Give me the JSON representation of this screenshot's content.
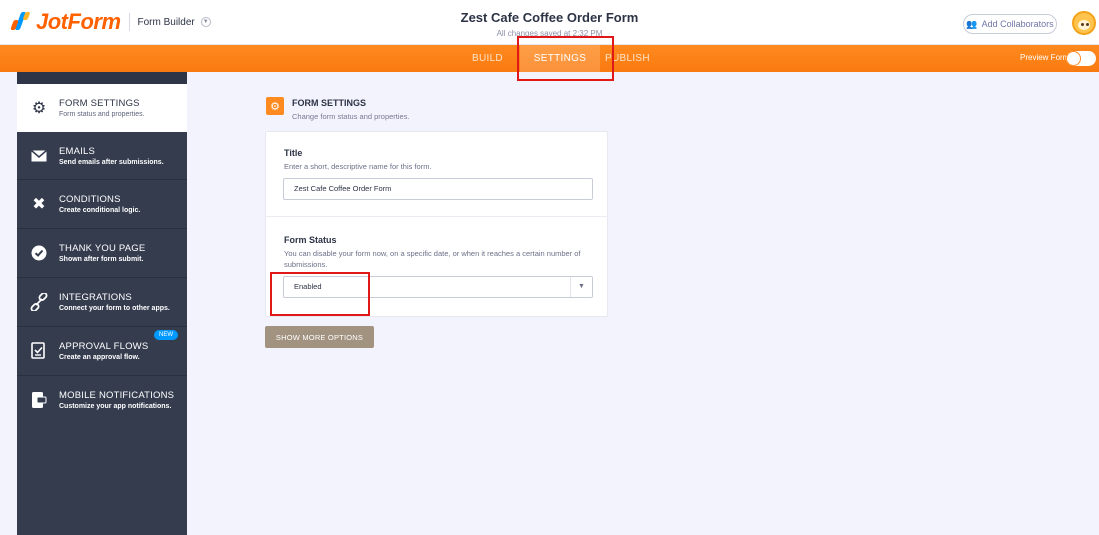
{
  "header": {
    "logo_text": "JotForm",
    "builder_label": "Form Builder",
    "form_title": "Zest Cafe Coffee Order Form",
    "saved_status": "All changes saved at 2:32 PM",
    "collaborators_label": "Add Collaborators"
  },
  "nav": {
    "tabs": [
      {
        "label": "BUILD"
      },
      {
        "label": "SETTINGS"
      },
      {
        "label": "PUBLISH"
      }
    ],
    "active_tab": "SETTINGS",
    "preview_label": "Preview Form"
  },
  "sidebar": {
    "items": [
      {
        "title": "FORM SETTINGS",
        "subtitle": "Form status and properties.",
        "icon": "gear-icon"
      },
      {
        "title": "EMAILS",
        "subtitle": "Send emails after submissions.",
        "icon": "envelope-icon"
      },
      {
        "title": "CONDITIONS",
        "subtitle": "Create conditional logic.",
        "icon": "tools-icon"
      },
      {
        "title": "THANK YOU PAGE",
        "subtitle": "Shown after form submit.",
        "icon": "check-circle-icon"
      },
      {
        "title": "INTEGRATIONS",
        "subtitle": "Connect your form to other apps.",
        "icon": "link-icon"
      },
      {
        "title": "APPROVAL FLOWS",
        "subtitle": "Create an approval flow.",
        "icon": "approval-icon",
        "badge": "NEW"
      },
      {
        "title": "MOBILE NOTIFICATIONS",
        "subtitle": "Customize your app notifications.",
        "icon": "mobile-icon"
      }
    ]
  },
  "main": {
    "section_title": "FORM SETTINGS",
    "section_subtitle": "Change form status and properties.",
    "title_field": {
      "label": "Title",
      "help": "Enter a short, descriptive name for this form.",
      "value": "Zest Cafe Coffee Order Form"
    },
    "status_field": {
      "label": "Form Status",
      "help": "You can disable your form now, on a specific date, or when it reaches a certain number of submissions.",
      "value": "Enabled"
    },
    "more_options_label": "SHOW MORE OPTIONS"
  },
  "colors": {
    "accent_orange": "#ff8a1f",
    "sidebar_bg": "#343c4e",
    "annotation_red": "#e01818",
    "more_button": "#a29280"
  }
}
